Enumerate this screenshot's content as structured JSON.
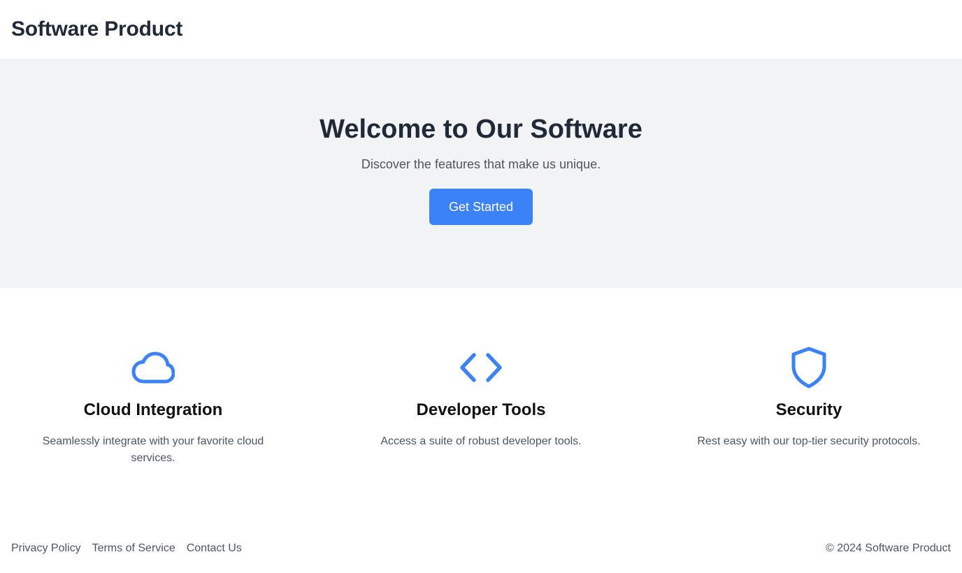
{
  "header": {
    "title": "Software Product"
  },
  "hero": {
    "heading": "Welcome to Our Software",
    "subtitle": "Discover the features that make us unique.",
    "cta_label": "Get Started"
  },
  "features": [
    {
      "icon": "cloud-icon",
      "title": "Cloud Integration",
      "description": "Seamlessly integrate with your favorite cloud services."
    },
    {
      "icon": "code-icon",
      "title": "Developer Tools",
      "description": "Access a suite of robust developer tools."
    },
    {
      "icon": "shield-icon",
      "title": "Security",
      "description": "Rest easy with our top-tier security protocols."
    }
  ],
  "footer": {
    "links": [
      {
        "label": "Privacy Policy"
      },
      {
        "label": "Terms of Service"
      },
      {
        "label": "Contact Us"
      }
    ],
    "copyright": "© 2024 Software Product"
  },
  "colors": {
    "accent": "#3b82f6",
    "hero_background": "#f2f3f5",
    "heading_text": "#1f2937",
    "body_text": "#4b5563"
  }
}
